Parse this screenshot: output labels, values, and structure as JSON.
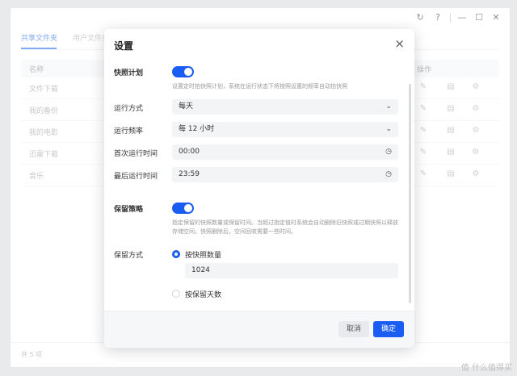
{
  "app": {
    "titlebar": {
      "refresh_icon": "↻",
      "help_icon": "?",
      "minimize_icon": "—",
      "maximize_icon": "☐",
      "close_icon": "✕"
    },
    "tabs": [
      {
        "label": "共享文件夹"
      },
      {
        "label": "用户文件夹"
      }
    ],
    "table": {
      "col_name": "名称",
      "col_actions": "操作",
      "rows": [
        {
          "name": "文件下载"
        },
        {
          "name": "我的备份"
        },
        {
          "name": "我的电影"
        },
        {
          "name": "迅雷下载"
        },
        {
          "name": "音乐"
        }
      ]
    },
    "footer": "共 5 项"
  },
  "dialog": {
    "title": "设置",
    "close": "×",
    "snapshot_plan": {
      "label": "快照计划",
      "enabled": true,
      "hint": "设置定时拍快照计划，系统在运行状态下将按照设置的频率自动拍快照"
    },
    "run_mode": {
      "label": "运行方式",
      "value": "每天"
    },
    "run_freq": {
      "label": "运行频率",
      "value": "每 12 小时"
    },
    "first_run": {
      "label": "首次运行时间",
      "value": "00:00"
    },
    "last_run": {
      "label": "最后运行时间",
      "value": "23:59"
    },
    "retention": {
      "label": "保留策略",
      "enabled": true,
      "hint": "指定保留的快照数量或保留时间。当超过指定值时系统会自动删除旧快照或过期快照以释放存储空间。快照删除后，空间回收需要一些时间。"
    },
    "retain_mode": {
      "label": "保留方式",
      "option_count": "按快照数量",
      "count_value": "1024",
      "option_days": "按保留天数"
    },
    "cancel": "取消",
    "ok": "确定"
  },
  "watermark": "值 什么值得买",
  "colors": {
    "accent": "#1a5df3",
    "tab_active": "#3d7cf2"
  }
}
